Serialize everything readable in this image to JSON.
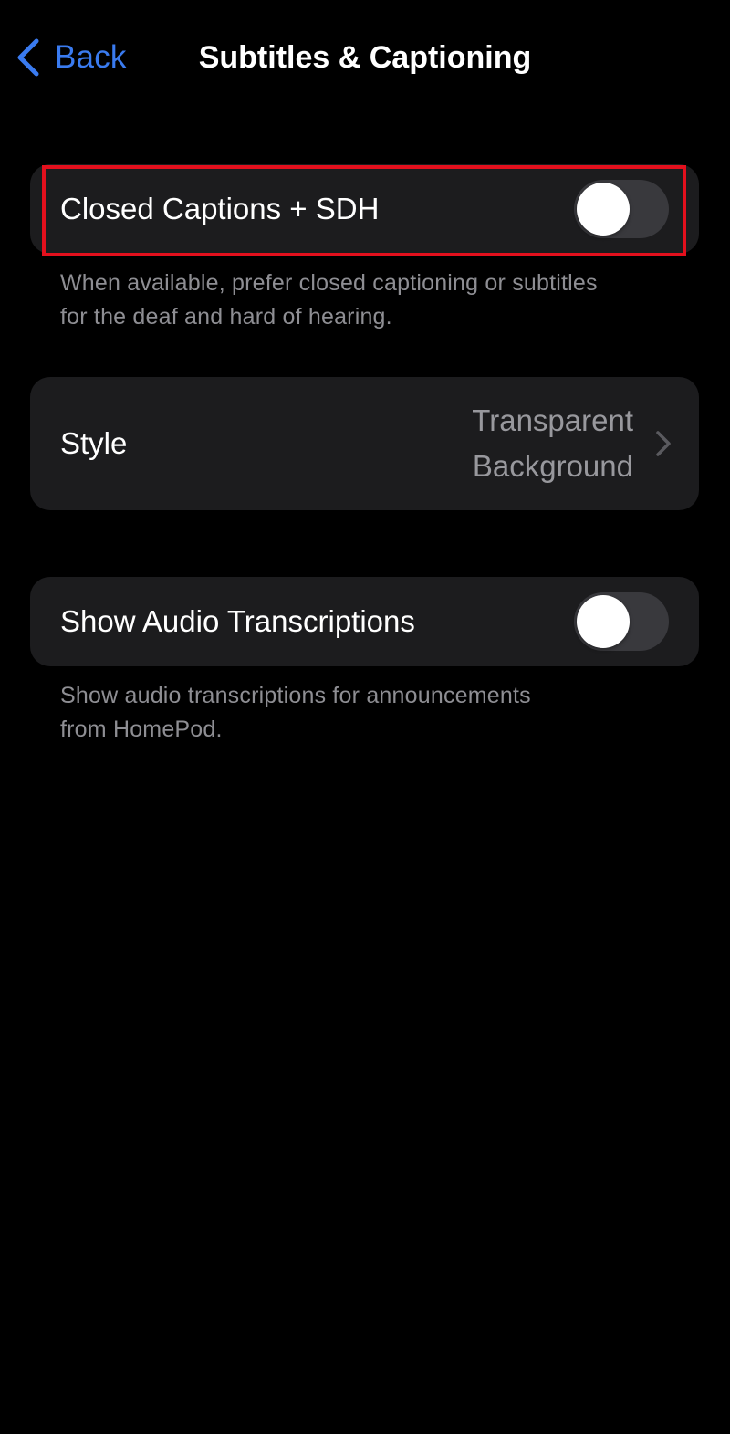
{
  "nav": {
    "back_label": "Back",
    "title": "Subtitles & Captioning"
  },
  "closed_captions": {
    "label": "Closed Captions + SDH",
    "enabled": false,
    "footnote_line1": "When available, prefer closed captioning or subtitles",
    "footnote_line2": "for the deaf and hard of hearing."
  },
  "style": {
    "label": "Style",
    "value_line1": "Transparent",
    "value_line2": "Background"
  },
  "audio_transcriptions": {
    "label": "Show Audio Transcriptions",
    "enabled": false,
    "footnote_line1": "Show audio transcriptions for announcements",
    "footnote_line2": "from HomePod."
  },
  "colors": {
    "accent": "#3a7bf0",
    "background": "#000000",
    "cell_background": "#1c1c1e",
    "secondary_text": "#8e8e93",
    "toggle_off": "#39393d",
    "highlight": "#e3101d"
  },
  "icons": {
    "back": "chevron-left-icon",
    "disclosure": "chevron-right-icon"
  }
}
